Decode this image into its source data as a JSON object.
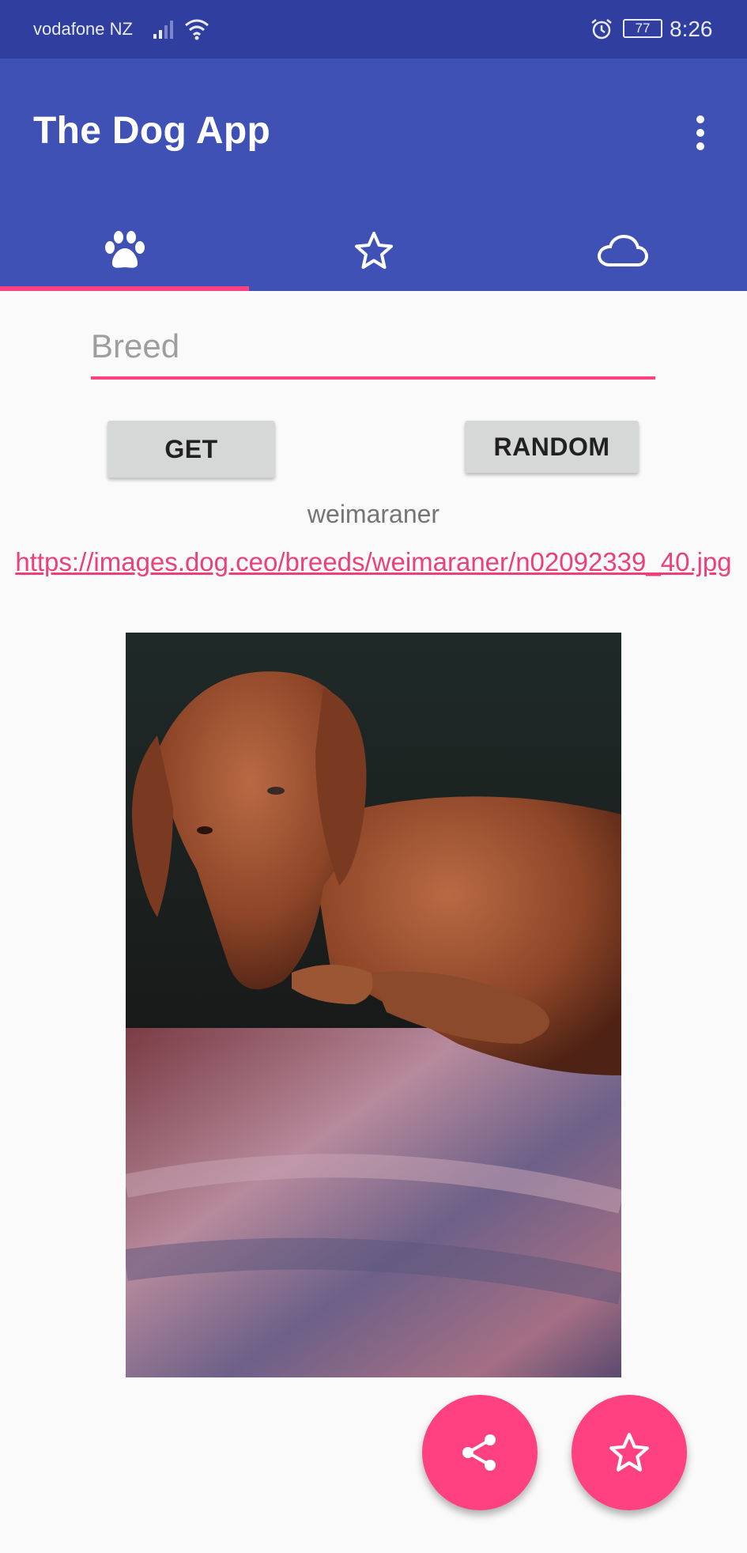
{
  "status_bar": {
    "carrier": "vodafone NZ",
    "battery": "77",
    "time": "8:26"
  },
  "app_bar": {
    "title": "The Dog App",
    "overflow_icon": "more-vert-icon"
  },
  "tabs": [
    {
      "icon": "paw-icon",
      "selected": true
    },
    {
      "icon": "star-outline-icon",
      "selected": false
    },
    {
      "icon": "cloud-outline-icon",
      "selected": false
    }
  ],
  "form": {
    "breed_placeholder": "Breed",
    "get_label": "GET",
    "random_label": "RANDOM"
  },
  "result": {
    "breed": "weimaraner",
    "url": "https://images.dog.ceo/breeds/weimaraner/n02092339_40.jpg"
  },
  "fabs": {
    "share_icon": "share-icon",
    "favorite_icon": "star-outline-icon"
  },
  "colors": {
    "primary": "#3f51b5",
    "primary_dark": "#303f9f",
    "accent": "#ff4081",
    "link": "#ec407a"
  }
}
